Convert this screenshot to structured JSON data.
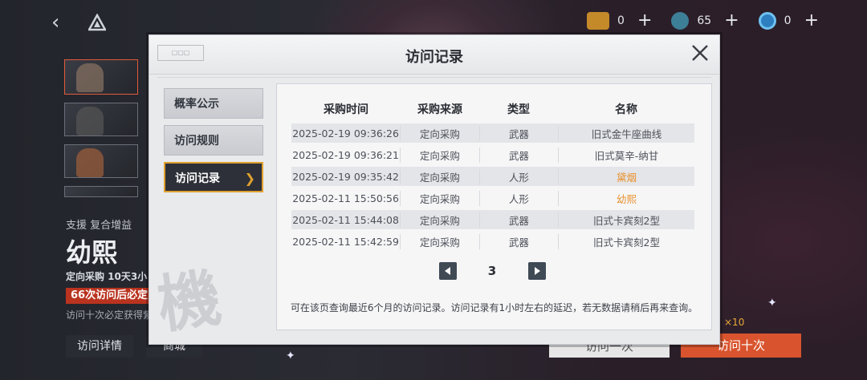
{
  "header": {
    "currencies": [
      {
        "icon": "ticket-icon",
        "value": "0"
      },
      {
        "icon": "gem-icon",
        "value": "65"
      },
      {
        "icon": "core-icon",
        "value": "0"
      }
    ]
  },
  "background": {
    "tags": "支援  复合增益",
    "character_name": "幼熙",
    "sub_line": "定向采购  10天3小",
    "red_banner": "66次访问后必定",
    "guarantee": "访问十次必定获得紫",
    "buttons": {
      "detail": "访问详情",
      "shop": "商城",
      "once": "访问一次",
      "ten": "访问十次",
      "ten_count": "×10"
    }
  },
  "modal": {
    "title": "访问记录",
    "tabs": [
      {
        "label": "概率公示"
      },
      {
        "label": "访问规则"
      },
      {
        "label": "访问记录"
      }
    ],
    "watermark": "機",
    "columns": [
      "采购时间",
      "采购来源",
      "类型",
      "名称"
    ],
    "rows": [
      [
        "2025-02-19 09:36:26",
        "定向采购",
        "武器",
        "旧式金牛座曲线"
      ],
      [
        "2025-02-19 09:36:21",
        "定向采购",
        "武器",
        "旧式莫辛-纳甘"
      ],
      [
        "2025-02-19 09:35:42",
        "定向采购",
        "人形",
        "黛烟"
      ],
      [
        "2025-02-11 15:50:56",
        "定向采购",
        "人形",
        "幼熙"
      ],
      [
        "2025-02-11 15:44:08",
        "定向采购",
        "武器",
        "旧式卡宾刻2型"
      ],
      [
        "2025-02-11 15:42:59",
        "定向采购",
        "武器",
        "旧式卡宾刻2型"
      ]
    ],
    "page": "3",
    "note": "可在该页查询最近6个月的访问记录。访问记录有1小时左右的延迟，若无数据请稍后再来查询。"
  },
  "colors": {
    "accent": "#e0a12f",
    "highlight_name": "#e8902c",
    "primary_button": "#d9542e"
  }
}
